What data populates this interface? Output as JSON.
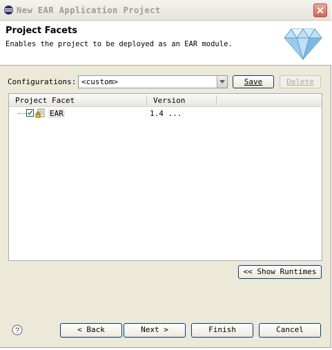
{
  "window": {
    "title": "New EAR Application Project"
  },
  "header": {
    "title": "Project Facets",
    "description": "Enables the project to be deployed as an EAR module."
  },
  "config": {
    "label": "Configurations:",
    "selected": "<custom>",
    "save_label": "Save",
    "delete_label": "Delete"
  },
  "table": {
    "columns": [
      "Project Facet",
      "Version"
    ],
    "rows": [
      {
        "facet": "EAR",
        "version": "1.4 ...",
        "checked": true
      }
    ]
  },
  "show_runtimes_label": "<< Show Runtimes",
  "footer": {
    "back_label": "< Back",
    "next_label": "Next >",
    "finish_label": "Finish",
    "cancel_label": "Cancel"
  }
}
